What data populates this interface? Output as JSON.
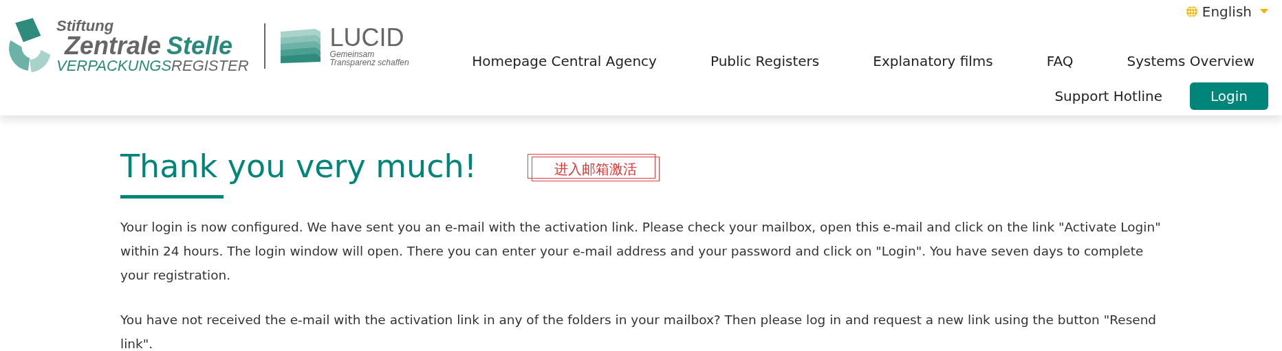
{
  "logo": {
    "stiftung": "Stiftung",
    "name_parts": [
      {
        "text": "Zentrale",
        "color": "#666666"
      },
      {
        "text": "Stelle",
        "color": "#2a8a7a"
      }
    ],
    "register_parts": [
      {
        "text": "VERPACKUNGS",
        "color": "#2a8a7a"
      },
      {
        "text": "REGISTER",
        "color": "#666666"
      }
    ],
    "lucid": {
      "title": "LUCID",
      "line_1": "Gemeinsam",
      "line_2": "Transparenz schaffen"
    }
  },
  "language": {
    "label": "English"
  },
  "nav": [
    {
      "label": "Homepage Central Agency",
      "kind": "link"
    },
    {
      "label": "Public Registers",
      "kind": "link"
    },
    {
      "label": "Explanatory films",
      "kind": "link"
    },
    {
      "label": "FAQ",
      "kind": "link"
    },
    {
      "label": "Systems Overview",
      "kind": "link"
    },
    {
      "label": "Support Hotline",
      "kind": "link"
    },
    {
      "label": "Login",
      "kind": "button"
    }
  ],
  "heading": "Thank you very much!",
  "annotation": {
    "text": "进入邮箱激活"
  },
  "paragraphs": [
    "Your login is now configured. We have sent you an e-mail with the activation link. Please check your mailbox, open this e-mail and click on the link \"Activate Login\" within 24 hours. The login window will open. There you can enter your e-mail address and your password and click on \"Login\". You have seven days to complete your registration.",
    "You have not received the e-mail with the activation link in any of the folders in your mailbox? Then please log in and request a new link using the button \"Resend link\"."
  ]
}
